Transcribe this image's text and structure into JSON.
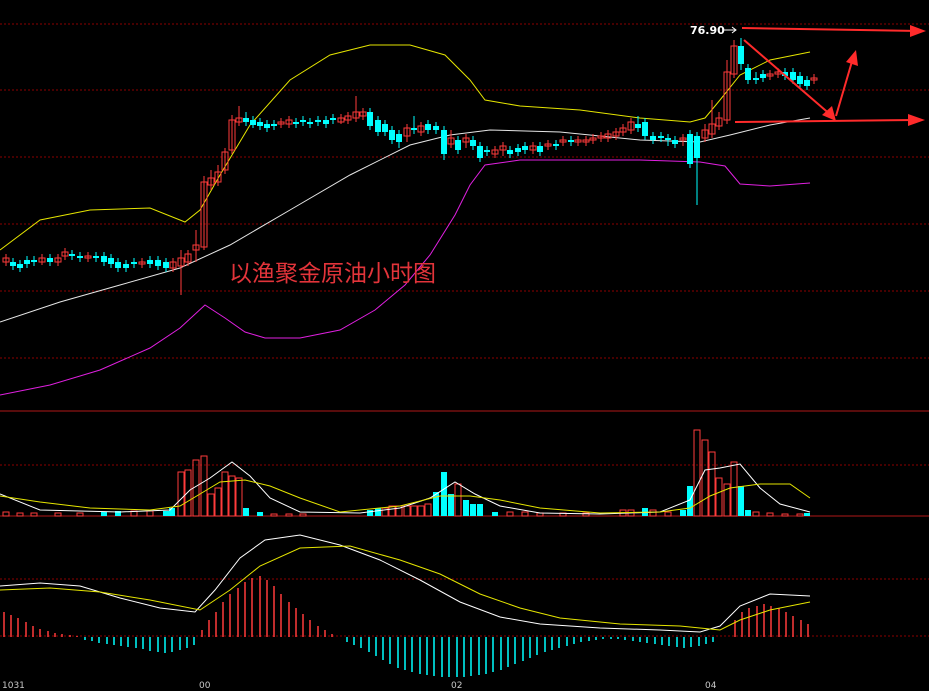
{
  "chart_data": [
    {
      "type": "candlestick",
      "title": "",
      "annotation_text": "以渔聚金原油小时图",
      "price_label": "76.90",
      "indicators": [
        "bollinger_upper",
        "bollinger_middle",
        "bollinger_lower"
      ],
      "grid": true,
      "colors": {
        "up": "#ff3b3b",
        "down": "#00ffff",
        "upper_band": "#e5e500",
        "middle_band": "#e6e6e6",
        "lower_band": "#e020e0",
        "annotation": "#e2343a",
        "arrows": "#ff2b2b",
        "grid": "#8b0000"
      }
    },
    {
      "type": "bar",
      "title": "",
      "subtype": "volume",
      "indicators": [
        "volume_ma_short",
        "volume_ma_long"
      ],
      "colors": {
        "up": "#ff3b3b",
        "down": "#00ffff",
        "ma_short": "#ffffff",
        "ma_long": "#e5e500"
      }
    },
    {
      "type": "bar",
      "title": "",
      "subtype": "macd_histogram",
      "indicators": [
        "dif",
        "dea"
      ],
      "colors": {
        "positive": "#ff3b3b",
        "negative": "#00ffff",
        "dif": "#ffffff",
        "dea": "#e5e500"
      }
    }
  ],
  "x_ticks": [
    "1031",
    "00",
    "02",
    "04"
  ]
}
